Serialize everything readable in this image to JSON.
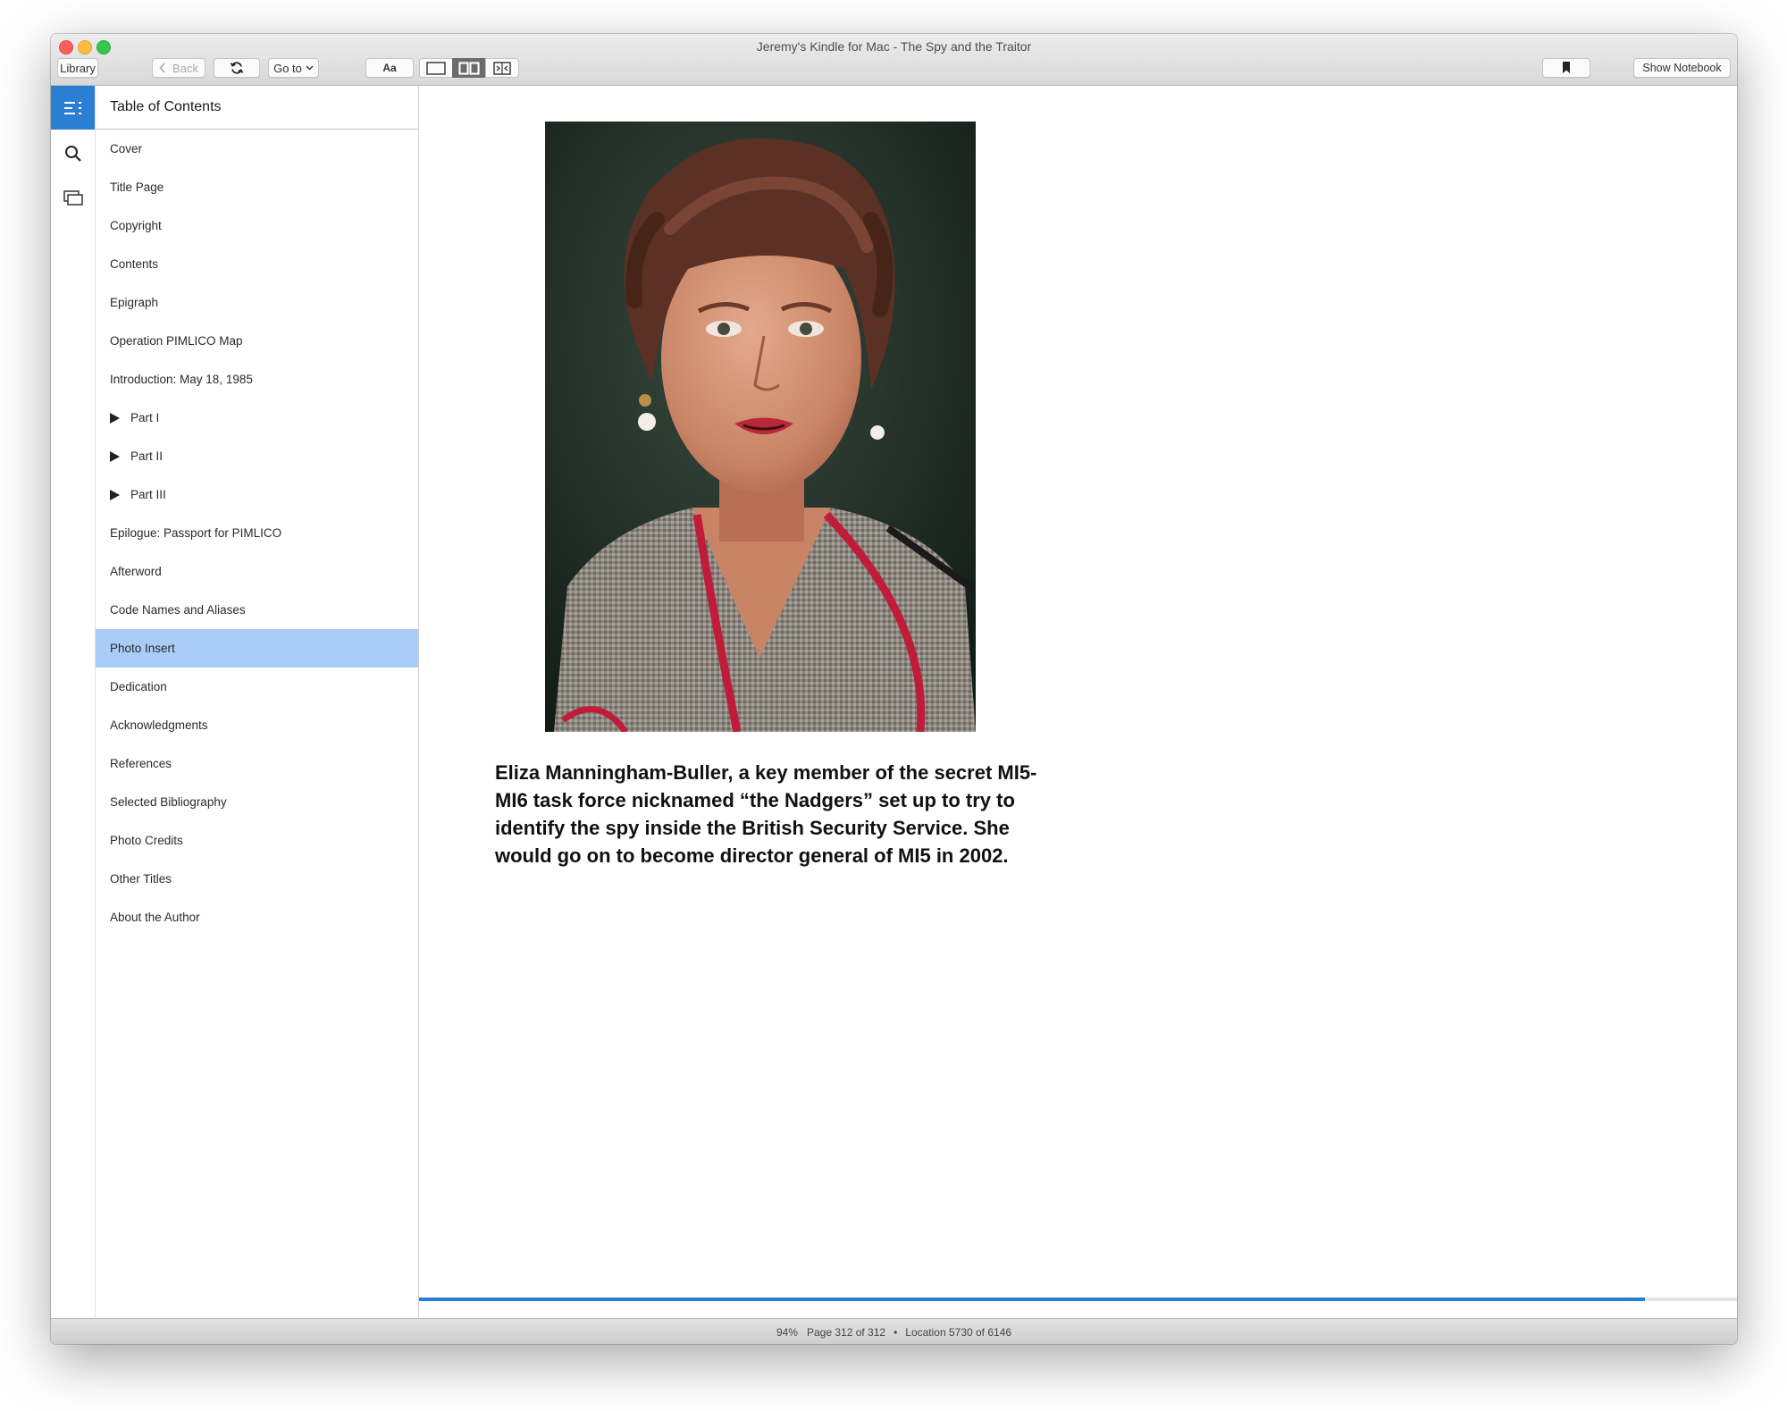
{
  "window": {
    "title": "Jeremy's Kindle for Mac - The Spy and the Traitor"
  },
  "toolbar": {
    "library_label": "Library",
    "back_label": "Back",
    "goto_label": "Go to",
    "font_label": "Aa",
    "show_notebook_label": "Show Notebook",
    "icons": [
      "chevron-left-icon",
      "sync-icon",
      "chevron-down-icon",
      "single-page-icon",
      "two-page-icon",
      "fullscreen-icon",
      "bookmark-icon"
    ]
  },
  "rail": {
    "icons": [
      "toc-icon",
      "search-icon",
      "flashcards-icon"
    ]
  },
  "toc": {
    "header": "Table of Contents",
    "items": [
      {
        "label": "Cover"
      },
      {
        "label": "Title Page"
      },
      {
        "label": "Copyright"
      },
      {
        "label": "Contents"
      },
      {
        "label": "Epigraph"
      },
      {
        "label": "Operation PIMLICO Map"
      },
      {
        "label": "Introduction: May 18, 1985"
      },
      {
        "label": "Part I"
      },
      {
        "label": "Part II"
      },
      {
        "label": "Part III"
      },
      {
        "label": "Epilogue: Passport for PIMLICO"
      },
      {
        "label": "Afterword"
      },
      {
        "label": "Code Names and Aliases"
      },
      {
        "label": "Photo Insert"
      },
      {
        "label": "Dedication"
      },
      {
        "label": "Acknowledgments"
      },
      {
        "label": "References"
      },
      {
        "label": "Selected Bibliography"
      },
      {
        "label": "Photo Credits"
      },
      {
        "label": "Other Titles"
      },
      {
        "label": "About the Author"
      }
    ],
    "expandable": [
      "Part I",
      "Part II",
      "Part III"
    ],
    "selected": "Photo Insert"
  },
  "page": {
    "caption": "Eliza Manningham-Buller, a key member of the secret MI5-MI6 task force nicknamed “the Nadgers” set up to try to identify the spy inside the British Security Service. She would go on to become director general of MI5 in 2002."
  },
  "status": {
    "percent": "94%",
    "page": "Page 312 of 312",
    "separator": "•",
    "location": "Location 5730 of 6146",
    "progress_fraction": 0.93
  },
  "colors": {
    "accent": "#2a7fd4",
    "selection": "#a9cdf6"
  }
}
